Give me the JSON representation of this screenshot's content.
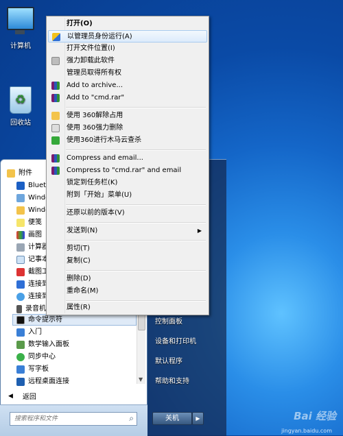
{
  "desktop": {
    "icons": [
      {
        "label": "计算机"
      },
      {
        "label": "回收站"
      }
    ]
  },
  "context_menu": {
    "items": [
      {
        "label": "打开(O)",
        "bold": true,
        "icon": ""
      },
      {
        "label": "以管理员身份运行(A)",
        "icon": "shield-icon",
        "highlighted": true
      },
      {
        "label": "打开文件位置(I)",
        "icon": ""
      },
      {
        "label": "强力卸载此软件",
        "icon": "trash-icon"
      },
      {
        "label": "管理员取得所有权",
        "icon": ""
      },
      {
        "label": "Add to archive...",
        "icon": "winrar-icon"
      },
      {
        "label": "Add to \"cmd.rar\"",
        "icon": "winrar-icon"
      },
      {
        "label": "使用 360解除占用",
        "icon": "folder-icon"
      },
      {
        "label": "使用 360强力删除",
        "icon": "printer-icon"
      },
      {
        "label": "使用360进行木马云查杀",
        "icon": "360-icon"
      },
      {
        "label": "Compress and email...",
        "icon": "winrar-icon"
      },
      {
        "label": "Compress to \"cmd.rar\" and email",
        "icon": "winrar-icon"
      },
      {
        "label": "锁定到任务栏(K)",
        "icon": ""
      },
      {
        "label": "附到「开始」菜单(U)",
        "icon": ""
      },
      {
        "label": "还原以前的版本(V)",
        "icon": ""
      },
      {
        "label": "发送到(N)",
        "icon": "",
        "submenu_arrow": "▶"
      },
      {
        "label": "剪切(T)",
        "icon": ""
      },
      {
        "label": "复制(C)",
        "icon": ""
      },
      {
        "label": "删除(D)",
        "icon": ""
      },
      {
        "label": "重命名(M)",
        "icon": ""
      },
      {
        "label": "属性(R)",
        "icon": ""
      }
    ]
  },
  "start_menu": {
    "programs": [
      {
        "label": "附件",
        "icon": "folder-icon"
      },
      {
        "label": "Blueto",
        "icon": "bluetooth-icon"
      },
      {
        "label": "Windo",
        "icon": "window-icon"
      },
      {
        "label": "Windo",
        "icon": "folder-icon"
      },
      {
        "label": "便笺",
        "icon": "sticky-note-icon"
      },
      {
        "label": "画图",
        "icon": "paint-icon"
      },
      {
        "label": "计算器",
        "icon": "calculator-icon"
      },
      {
        "label": "记事本",
        "icon": "notepad-icon"
      },
      {
        "label": "截图工",
        "icon": "snipping-icon"
      },
      {
        "label": "连接到",
        "icon": "projector-icon"
      },
      {
        "label": "连接到",
        "icon": "network-icon"
      },
      {
        "label": "录音机",
        "icon": "microphone-icon"
      },
      {
        "label": "命令提示符",
        "icon": "cmd-icon",
        "selected": true
      },
      {
        "label": "入门",
        "icon": "getting-started-icon"
      },
      {
        "label": "数学输入面板",
        "icon": "math-icon"
      },
      {
        "label": "同步中心",
        "icon": "sync-icon"
      },
      {
        "label": "写字板",
        "icon": "wordpad-icon"
      },
      {
        "label": "远程桌面连接",
        "icon": "remote-desktop-icon"
      }
    ],
    "back_label": "返回",
    "search_placeholder": "搜索程序和文件",
    "right_items": [
      {
        "label": "控制面板"
      },
      {
        "label": "设备和打印机"
      },
      {
        "label": "默认程序"
      },
      {
        "label": "帮助和支持"
      }
    ],
    "shutdown_label": "关机"
  },
  "watermark": {
    "brand": "Bai 经验",
    "url": "jingyan.baidu.com"
  }
}
